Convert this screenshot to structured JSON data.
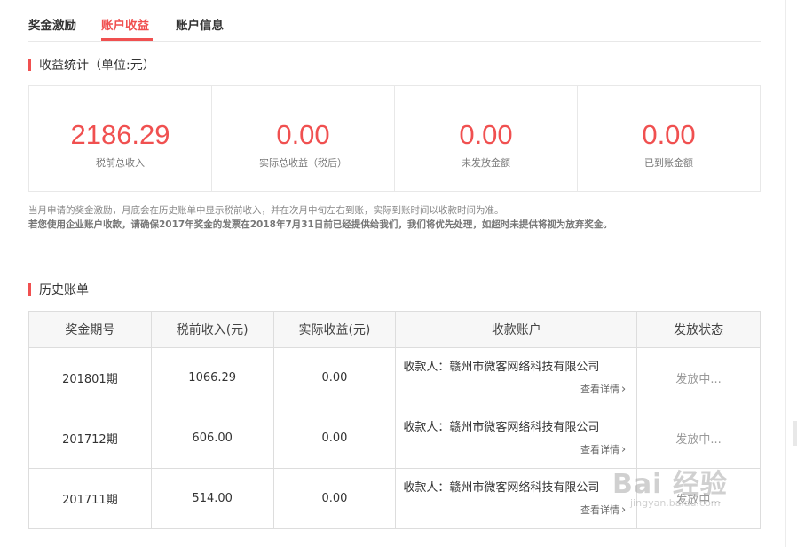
{
  "tabs": [
    {
      "label": "奖金激励",
      "active": false
    },
    {
      "label": "账户收益",
      "active": true
    },
    {
      "label": "账户信息",
      "active": false
    }
  ],
  "stats_section": {
    "title": "收益统计（单位:元）"
  },
  "stats": [
    {
      "value": "2186.29",
      "label": "税前总收入"
    },
    {
      "value": "0.00",
      "label": "实际总收益（税后）"
    },
    {
      "value": "0.00",
      "label": "未发放金额"
    },
    {
      "value": "0.00",
      "label": "已到账金额"
    }
  ],
  "notes": {
    "line1": "当月申请的奖金激励，月底会在历史账单中显示税前收入，并在次月中旬左右到账，实际到账时间以收款时间为准。",
    "line2": "若您使用企业账户收款，请确保2017年奖金的发票在2018年7月31日前已经提供给我们，我们将优先处理，如超时未提供将视为放弃奖金。"
  },
  "history_section": {
    "title": "历史账单"
  },
  "table": {
    "headers": [
      "奖金期号",
      "税前收入(元)",
      "实际收益(元)",
      "收款账户",
      "发放状态"
    ],
    "rows": [
      {
        "period": "201801期",
        "pretax": "1066.29",
        "actual": "0.00",
        "payee": "收款人：赣州市微客网络科技有限公司",
        "detail": "查看详情",
        "status": "发放中..."
      },
      {
        "period": "201712期",
        "pretax": "606.00",
        "actual": "0.00",
        "payee": "收款人：赣州市微客网络科技有限公司",
        "detail": "查看详情",
        "status": "发放中..."
      },
      {
        "period": "201711期",
        "pretax": "514.00",
        "actual": "0.00",
        "payee": "收款人：赣州市微客网络科技有限公司",
        "detail": "查看详情",
        "status": "发放中..."
      }
    ]
  },
  "watermark": {
    "brand": "Bai 经验",
    "url": "jingyan.baidu.com"
  },
  "colors": {
    "accent": "#f05050",
    "border": "#e8e8e8",
    "header_bg": "#f7f7f7"
  },
  "icons": {
    "detail": "chevron-right-icon"
  }
}
